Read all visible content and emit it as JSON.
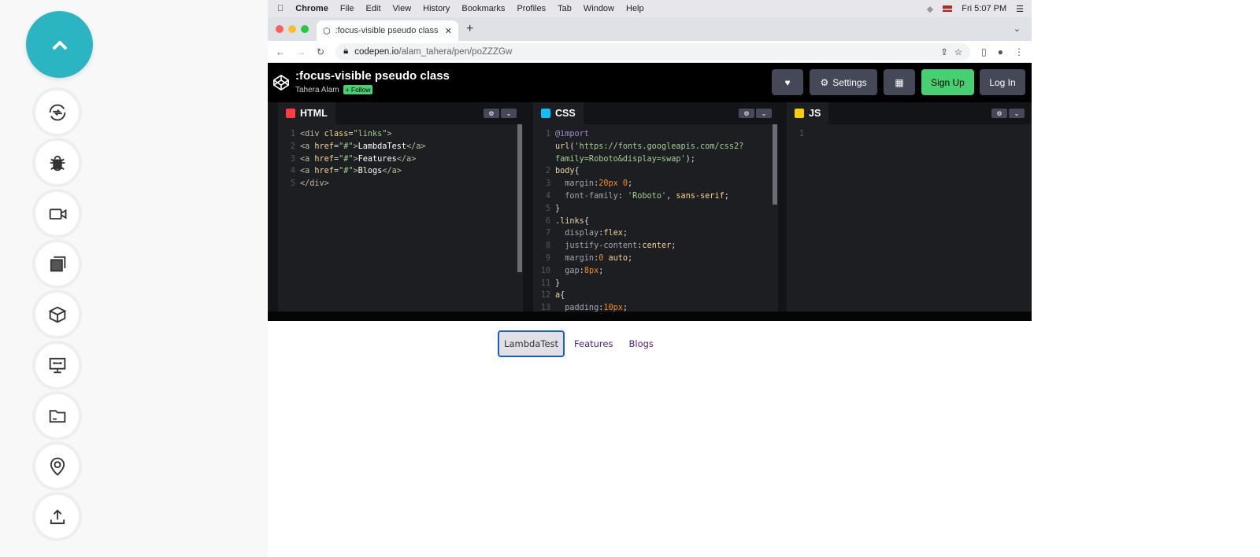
{
  "sidebar": {
    "items": [
      {
        "icon": "switch-arrows-icon"
      },
      {
        "icon": "bug-icon"
      },
      {
        "icon": "video-camera-icon"
      },
      {
        "icon": "gallery-icon"
      },
      {
        "icon": "cube-icon"
      },
      {
        "icon": "resolution-monitor-icon"
      },
      {
        "icon": "folder-icon"
      },
      {
        "icon": "location-pin-icon"
      },
      {
        "icon": "upload-icon"
      }
    ],
    "accent": "#2bb5c3"
  },
  "menubar": {
    "items": [
      "Chrome",
      "File",
      "Edit",
      "View",
      "History",
      "Bookmarks",
      "Profiles",
      "Tab",
      "Window",
      "Help"
    ],
    "clock": "Fri 5:07 PM"
  },
  "browser": {
    "tab_title": ":focus-visible pseudo class",
    "url_host": "codepen.io",
    "url_path": "/alam_tahera/pen/poZZZGw"
  },
  "codepen": {
    "title": ":focus-visible pseudo class",
    "author": "Tahera Alam",
    "follow": "+ Follow",
    "settings": "Settings",
    "signup": "Sign Up",
    "login": "Log In",
    "signup_color": "#47cf73"
  },
  "panes": [
    {
      "name": "HTML",
      "lines": [
        [
          [
            "t-tag",
            "<div "
          ],
          [
            "t-attr",
            "class"
          ],
          [
            "t-p",
            "="
          ],
          [
            "t-str",
            "\"links\""
          ],
          [
            "t-tag",
            ">"
          ]
        ],
        [
          [
            "t-tag",
            "<a "
          ],
          [
            "t-attr",
            "href"
          ],
          [
            "t-p",
            "="
          ],
          [
            "t-str",
            "\"#\""
          ],
          [
            "t-tag",
            ">"
          ],
          [
            "t-txt",
            "LambdaTest"
          ],
          [
            "t-tag",
            "</a>"
          ]
        ],
        [
          [
            "t-tag",
            "<a "
          ],
          [
            "t-attr",
            "href"
          ],
          [
            "t-p",
            "="
          ],
          [
            "t-str",
            "\"#\""
          ],
          [
            "t-tag",
            ">"
          ],
          [
            "t-txt",
            "Features"
          ],
          [
            "t-tag",
            "</a>"
          ]
        ],
        [
          [
            "t-tag",
            "<a "
          ],
          [
            "t-attr",
            "href"
          ],
          [
            "t-p",
            "="
          ],
          [
            "t-str",
            "\"#\""
          ],
          [
            "t-tag",
            ">"
          ],
          [
            "t-txt",
            "Blogs"
          ],
          [
            "t-tag",
            "</a>"
          ]
        ],
        [
          [
            "t-tag",
            "</div>"
          ]
        ]
      ],
      "numbers": [
        "1",
        "2",
        "3",
        "4",
        "5"
      ]
    },
    {
      "name": "CSS",
      "lines": [
        [
          [
            "t-key",
            "@import"
          ]
        ],
        [
          [
            "t-val",
            "url"
          ],
          [
            "t-p",
            "("
          ],
          [
            "t-str",
            "'https://fonts.googleapis.com/css2?"
          ]
        ],
        [
          [
            "t-str",
            "family=Roboto&display=swap'"
          ],
          [
            "t-p",
            ");"
          ]
        ],
        [
          [
            "t-sel",
            "body"
          ],
          [
            "t-p",
            "{"
          ]
        ],
        [
          [
            "t-prop",
            "  margin"
          ],
          [
            "t-p",
            ":"
          ],
          [
            "t-num",
            "20px 0"
          ],
          [
            "t-p",
            ";"
          ]
        ],
        [
          [
            "t-prop",
            "  font-family"
          ],
          [
            "t-p",
            ": "
          ],
          [
            "t-str",
            "'Roboto'"
          ],
          [
            "t-p",
            ", "
          ],
          [
            "t-val",
            "sans-serif"
          ],
          [
            "t-p",
            ";"
          ]
        ],
        [
          [
            "t-p",
            "}"
          ]
        ],
        [
          [
            "t-sel",
            ".links"
          ],
          [
            "t-p",
            "{"
          ]
        ],
        [
          [
            "t-prop",
            "  display"
          ],
          [
            "t-p",
            ":"
          ],
          [
            "t-val",
            "flex"
          ],
          [
            "t-p",
            ";"
          ]
        ],
        [
          [
            "t-prop",
            "  justify-content"
          ],
          [
            "t-p",
            ":"
          ],
          [
            "t-val",
            "center"
          ],
          [
            "t-p",
            ";"
          ]
        ],
        [
          [
            "t-prop",
            "  margin"
          ],
          [
            "t-p",
            ":"
          ],
          [
            "t-num",
            "0"
          ],
          [
            "t-val",
            " auto"
          ],
          [
            "t-p",
            ";"
          ]
        ],
        [
          [
            "t-prop",
            "  gap"
          ],
          [
            "t-p",
            ":"
          ],
          [
            "t-num",
            "8px"
          ],
          [
            "t-p",
            ";"
          ]
        ],
        [
          [
            "t-p",
            "}"
          ]
        ],
        [
          [
            "t-sel",
            "a"
          ],
          [
            "t-p",
            "{"
          ]
        ],
        [
          [
            "t-prop",
            "  padding"
          ],
          [
            "t-p",
            ":"
          ],
          [
            "t-num",
            "10px"
          ],
          [
            "t-p",
            ";"
          ]
        ]
      ],
      "numbers": [
        "1",
        "",
        "",
        "2",
        "3",
        "4",
        "5",
        "6",
        "7",
        "8",
        "9",
        "10",
        "11",
        "12",
        "13"
      ]
    },
    {
      "name": "JS",
      "lines": [
        []
      ],
      "numbers": [
        "1"
      ]
    }
  ],
  "preview": {
    "links": [
      "LambdaTest",
      "Features",
      "Blogs"
    ]
  }
}
